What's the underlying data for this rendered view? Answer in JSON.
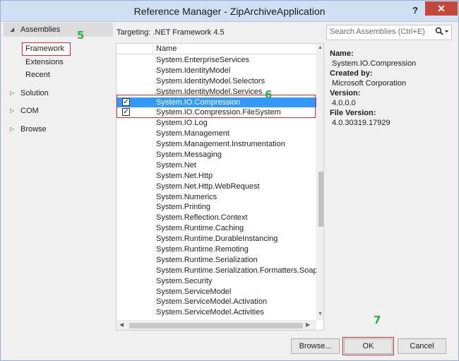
{
  "window": {
    "title": "Reference Manager - ZipArchiveApplication",
    "help_label": "?",
    "close_label": "✕"
  },
  "nav": {
    "assemblies": "Assemblies",
    "framework": "Framework",
    "extensions": "Extensions",
    "recent": "Recent",
    "solution": "Solution",
    "com": "COM",
    "browse": "Browse"
  },
  "annotations": {
    "a5": "5",
    "a6": "6",
    "a7": "7"
  },
  "targeting": "Targeting: .NET Framework 4.5",
  "search": {
    "placeholder": "Search Assemblies (Ctrl+E)",
    "icon": "search-icon"
  },
  "list": {
    "header_name": "Name",
    "rows": [
      {
        "name": "System.EnterpriseServices",
        "checked": false,
        "selected": false
      },
      {
        "name": "System.IdentityModel",
        "checked": false,
        "selected": false
      },
      {
        "name": "System.IdentityModel.Selectors",
        "checked": false,
        "selected": false
      },
      {
        "name": "System.IdentityModel.Services",
        "checked": false,
        "selected": false
      },
      {
        "name": "System.IO.Compression",
        "checked": true,
        "selected": true
      },
      {
        "name": "System.IO.Compression.FileSystem",
        "checked": true,
        "selected": false
      },
      {
        "name": "System.IO.Log",
        "checked": false,
        "selected": false
      },
      {
        "name": "System.Management",
        "checked": false,
        "selected": false
      },
      {
        "name": "System.Management.Instrumentation",
        "checked": false,
        "selected": false
      },
      {
        "name": "System.Messaging",
        "checked": false,
        "selected": false
      },
      {
        "name": "System.Net",
        "checked": false,
        "selected": false
      },
      {
        "name": "System.Net.Http",
        "checked": false,
        "selected": false
      },
      {
        "name": "System.Net.Http.WebRequest",
        "checked": false,
        "selected": false
      },
      {
        "name": "System.Numerics",
        "checked": false,
        "selected": false
      },
      {
        "name": "System.Printing",
        "checked": false,
        "selected": false
      },
      {
        "name": "System.Reflection.Context",
        "checked": false,
        "selected": false
      },
      {
        "name": "System.Runtime.Caching",
        "checked": false,
        "selected": false
      },
      {
        "name": "System.Runtime.DurableInstancing",
        "checked": false,
        "selected": false
      },
      {
        "name": "System.Runtime.Remoting",
        "checked": false,
        "selected": false
      },
      {
        "name": "System.Runtime.Serialization",
        "checked": false,
        "selected": false
      },
      {
        "name": "System.Runtime.Serialization.Formatters.Soap",
        "checked": false,
        "selected": false
      },
      {
        "name": "System.Security",
        "checked": false,
        "selected": false
      },
      {
        "name": "System.ServiceModel",
        "checked": false,
        "selected": false
      },
      {
        "name": "System.ServiceModel.Activation",
        "checked": false,
        "selected": false
      },
      {
        "name": "System.ServiceModel.Activities",
        "checked": false,
        "selected": false
      }
    ]
  },
  "details": {
    "name_label": "Name:",
    "name_value": "System.IO.Compression",
    "created_label": "Created by:",
    "created_value": "Microsoft Corporation",
    "version_label": "Version:",
    "version_value": "4.0.0.0",
    "file_version_label": "File Version:",
    "file_version_value": "4.0.30319.17929"
  },
  "buttons": {
    "browse": "Browse...",
    "ok": "OK",
    "cancel": "Cancel"
  },
  "colors": {
    "selection": "#3399ff",
    "annotation": "#2bab47",
    "highlight": "#d62e39",
    "titlebar": "#cfe0f5"
  }
}
